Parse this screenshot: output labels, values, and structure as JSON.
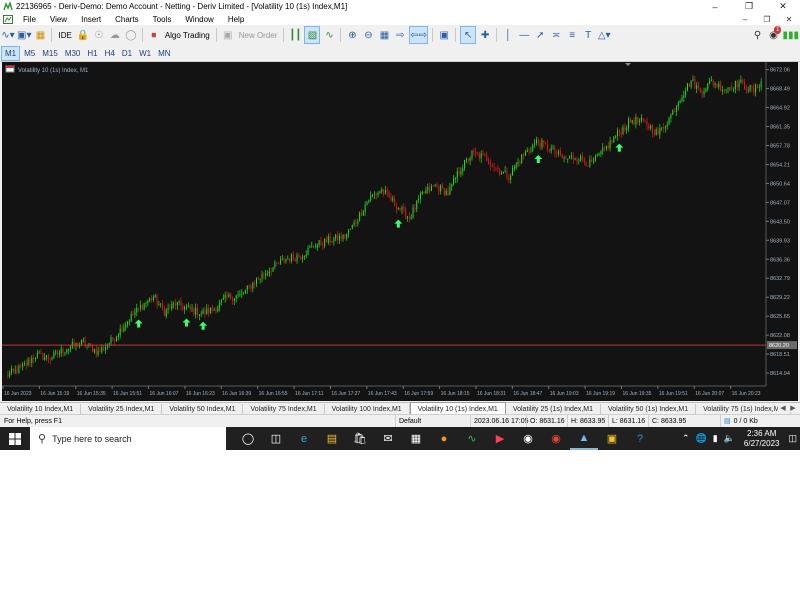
{
  "window": {
    "title": "22136965 - Deriv-Demo: Demo Account - Netting - Deriv Limited - [Volatility 10 (1s) Index,M1]"
  },
  "menu": [
    "File",
    "View",
    "Insert",
    "Charts",
    "Tools",
    "Window",
    "Help"
  ],
  "toolbar": {
    "ide_label": "IDE",
    "algo_trading_label": "Algo Trading",
    "new_order_label": "New Order",
    "notification_count": "1"
  },
  "timeframes": [
    "M1",
    "M5",
    "M15",
    "M30",
    "H1",
    "H4",
    "D1",
    "W1",
    "MN"
  ],
  "selected_timeframe": "M1",
  "chart": {
    "symbol_label": "Volatility 10 (1s) Index, M1",
    "current_price": "8620.20",
    "colors": {
      "background": "#131313",
      "bull": "#22dd22",
      "bear": "#e01818",
      "arrow": "#39ff6e",
      "price_line": "#c0392b",
      "axis_text": "#9fb4c8"
    }
  },
  "chart_data": {
    "type": "candlestick",
    "title": "Volatility 10 (1s) Index, M1",
    "y_ticks": [
      "8672.06",
      "8668.49",
      "8664.92",
      "8661.35",
      "8657.78",
      "8654.21",
      "8650.64",
      "8647.07",
      "8643.50",
      "8639.93",
      "8636.36",
      "8632.79",
      "8629.22",
      "8625.65",
      "8622.08",
      "8618.51",
      "8614.94"
    ],
    "x_ticks": [
      "16 Jun 2023",
      "16 Jun 15:19",
      "16 Jun 15:35",
      "16 Jun 15:51",
      "16 Jun 16:07",
      "16 Jun 16:23",
      "16 Jun 16:39",
      "16 Jun 16:55",
      "16 Jun 17:11",
      "16 Jun 17:27",
      "16 Jun 17:43",
      "16 Jun 17:59",
      "16 Jun 18:15",
      "16 Jun 18:31",
      "16 Jun 18:47",
      "16 Jun 19:03",
      "16 Jun 19:19",
      "16 Jun 19:35",
      "16 Jun 19:51",
      "16 Jun 20:07",
      "16 Jun 20:23"
    ],
    "ylim": [
      8612.5,
      8673.5
    ],
    "price_line": 8620.2,
    "grid": false,
    "path": [
      [
        0,
        8614.5
      ],
      [
        8,
        8615.8
      ],
      [
        16,
        8618.3
      ],
      [
        24,
        8617.8
      ],
      [
        33,
        8619.6
      ],
      [
        42,
        8620.7
      ],
      [
        50,
        8618.8
      ],
      [
        58,
        8621.3
      ],
      [
        66,
        8624.8
      ],
      [
        73,
        8627.4
      ],
      [
        80,
        8629.3
      ],
      [
        86,
        8626.4
      ],
      [
        92,
        8628.0
      ],
      [
        99,
        8627.0
      ],
      [
        106,
        8626.2
      ],
      [
        113,
        8627.0
      ],
      [
        120,
        8629.2
      ],
      [
        128,
        8629.6
      ],
      [
        136,
        8632.5
      ],
      [
        144,
        8634.6
      ],
      [
        152,
        8636.4
      ],
      [
        160,
        8637.1
      ],
      [
        168,
        8639.0
      ],
      [
        176,
        8640.0
      ],
      [
        184,
        8640.6
      ],
      [
        190,
        8643.5
      ],
      [
        197,
        8647.8
      ],
      [
        204,
        8649.4
      ],
      [
        212,
        8646.5
      ],
      [
        219,
        8644.2
      ],
      [
        226,
        8648.6
      ],
      [
        233,
        8650.2
      ],
      [
        240,
        8648.8
      ],
      [
        246,
        8653.0
      ],
      [
        253,
        8656.2
      ],
      [
        260,
        8655.6
      ],
      [
        266,
        8653.5
      ],
      [
        273,
        8652.0
      ],
      [
        280,
        8655.6
      ],
      [
        288,
        8658.5
      ],
      [
        296,
        8657.0
      ],
      [
        303,
        8655.2
      ],
      [
        310,
        8655.6
      ],
      [
        318,
        8654.2
      ],
      [
        325,
        8657.0
      ],
      [
        333,
        8660.4
      ],
      [
        340,
        8662.6
      ],
      [
        347,
        8662.0
      ],
      [
        354,
        8660.0
      ],
      [
        360,
        8662.8
      ],
      [
        366,
        8666.8
      ],
      [
        372,
        8670.0
      ],
      [
        377,
        8668.0
      ],
      [
        383,
        8669.8
      ],
      [
        390,
        8668.4
      ],
      [
        398,
        8669.6
      ],
      [
        406,
        8668.0
      ],
      [
        410,
        8670.0
      ]
    ],
    "signal_arrows_at": [
      72,
      98,
      107,
      213,
      289,
      333
    ]
  },
  "tabs": [
    "Volatility 10 Index,M1",
    "Volatility 25 Index,M1",
    "Volatility 50 Index,M1",
    "Volatility 75 Index,M1",
    "Volatility 100 Index,M1",
    "Volatility 10 (1s) Index,M1",
    "Volatility 25 (1s) Index,M1",
    "Volatility 50 (1s) Index,M1",
    "Volatility 75 (1s) Index,M1"
  ],
  "active_tab": 5,
  "status": {
    "help": "For Help, press F1",
    "profile": "Default",
    "time": "2023.06.16 17:05",
    "open": "O: 8631.16",
    "high": "H: 8633.95",
    "low": "L: 8631.16",
    "close": "C: 8633.95",
    "traffic": "0 / 0 Kb"
  },
  "taskbar": {
    "search_placeholder": "Type here to search",
    "time": "2:36 AM",
    "date": "6/27/2023"
  }
}
